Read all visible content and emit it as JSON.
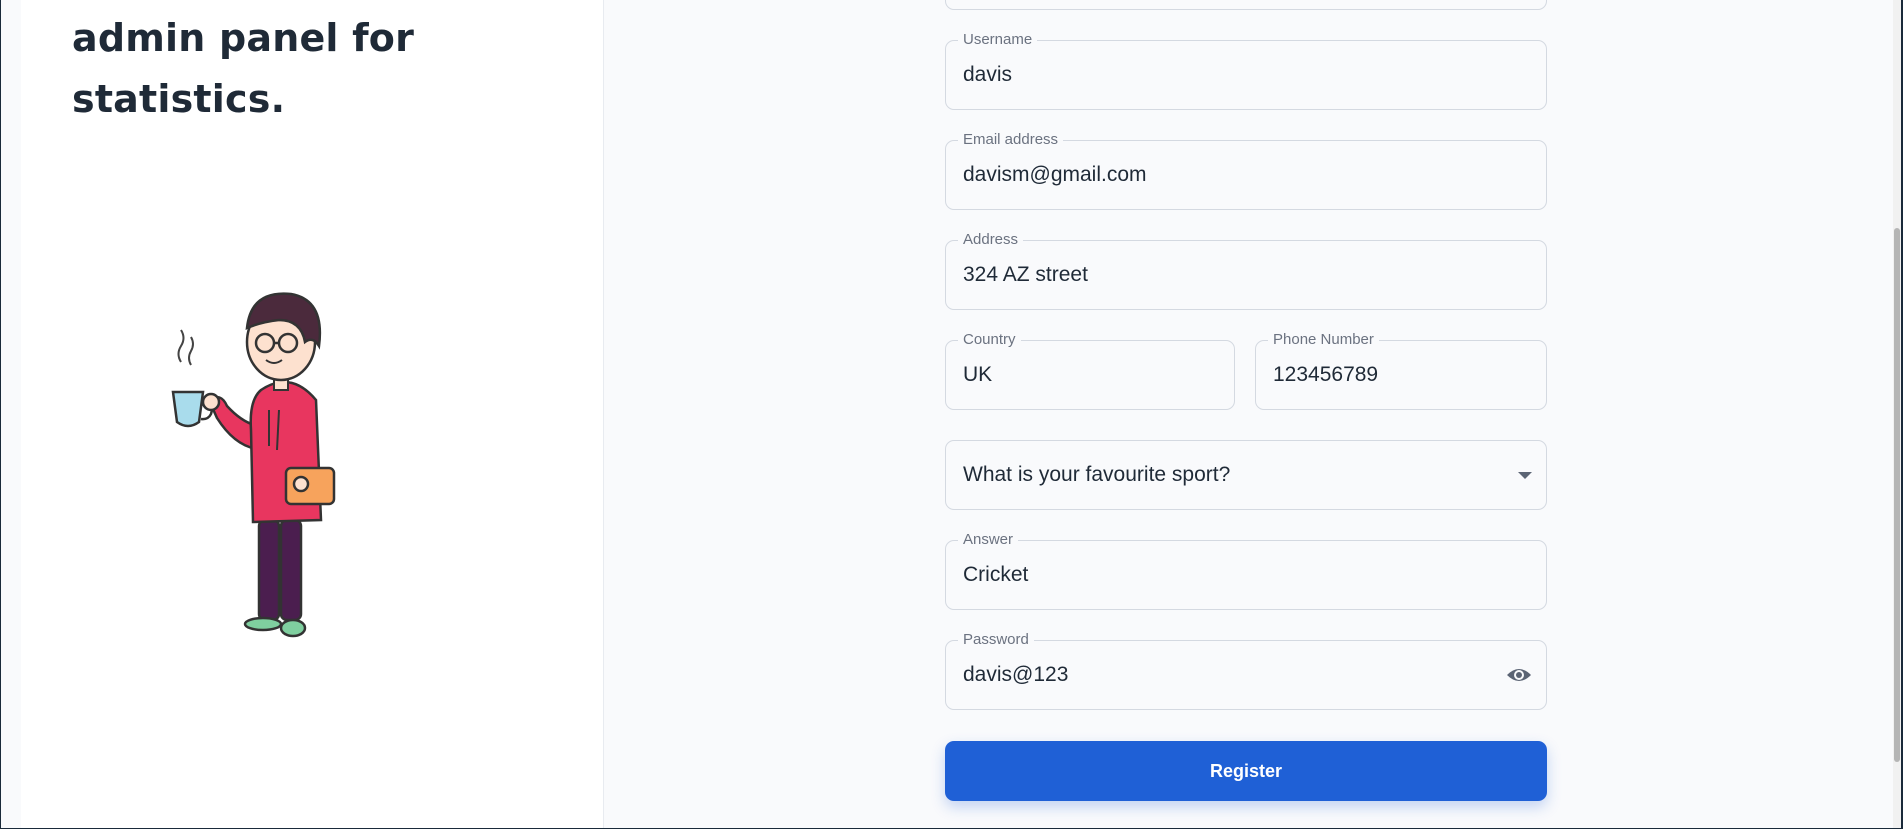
{
  "left": {
    "headline_line1": "admin panel for",
    "headline_line2": "statistics."
  },
  "form": {
    "username": {
      "label": "Username",
      "value": "davis"
    },
    "email": {
      "label": "Email address",
      "value": "davism@gmail.com"
    },
    "address": {
      "label": "Address",
      "value": "324 AZ street"
    },
    "country": {
      "label": "Country",
      "value": "UK"
    },
    "phone": {
      "label": "Phone Number",
      "value": "123456789"
    },
    "security_question": {
      "value": "What is your favourite sport?"
    },
    "answer": {
      "label": "Answer",
      "value": "Cricket"
    },
    "password": {
      "label": "Password",
      "value": "davis@123"
    },
    "register_label": "Register"
  },
  "icons": {
    "password_toggle": "eye-icon",
    "select_arrow": "chevron-down-icon"
  },
  "colors": {
    "primary": "#1f60d6",
    "text": "#1f2a37",
    "border": "#d4d9e1",
    "hoodie": "#e8365f"
  }
}
